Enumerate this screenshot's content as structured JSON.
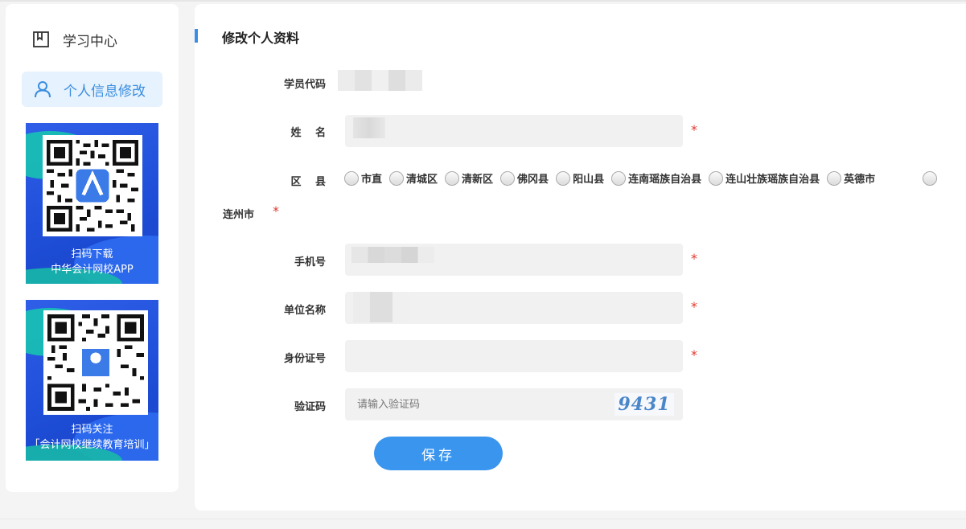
{
  "sidebar": {
    "items": [
      {
        "label": "学习中心",
        "icon": "bookmark-icon"
      },
      {
        "label": "个人信息修改",
        "icon": "user-icon",
        "active": true
      }
    ],
    "promos": [
      {
        "line1": "扫码下载",
        "line2": "中华会计网校APP"
      },
      {
        "line1": "扫码关注",
        "line2": "「会计网校继续教育培训」"
      }
    ]
  },
  "main": {
    "title": "修改个人资料",
    "labels": {
      "student_code": "学员代码",
      "name": "姓　 名",
      "district": "区　 县",
      "phone": "手机号",
      "company": "单位名称",
      "id_number": "身份证号",
      "captcha": "验证码"
    },
    "required_mark": "*",
    "districts": [
      "市直",
      "清城区",
      "清新区",
      "佛冈县",
      "阳山县",
      "连南瑶族自治县",
      "连山壮族瑶族自治县",
      "英德市"
    ],
    "district_wrap": "连州市",
    "captcha_placeholder": "请输入验证码",
    "captcha_text": "9431",
    "save_label": "保存"
  },
  "colors": {
    "accent": "#3a95ee",
    "active_nav_bg": "#e6f2fd",
    "required": "#e0392f"
  }
}
